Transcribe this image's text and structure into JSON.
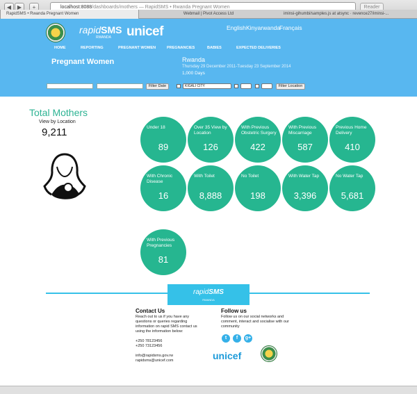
{
  "browser": {
    "url_host": "localhost:8088",
    "url_path": "/dashboards/mothers",
    "url_suffix": " — RapidSMS • Rwanda Pregnant Women",
    "reader_label": "Reader",
    "tabs": [
      "RapidSMS • Rwanda Pregnant Women",
      "Webmail | Pivot Access Ltd",
      "iminsi-gihumbi/samples.js at atsync · revence27/iminsi-..."
    ]
  },
  "header": {
    "logo_rapid": "rapid",
    "logo_sms": "SMS",
    "logo_rwanda": "RWANDA",
    "logo_unicef": "unicef",
    "languages": [
      "English",
      "Kinyarwanda",
      "Français"
    ],
    "menu": [
      "HOME",
      "REPORTING",
      "PREGNANT WOMEN",
      "PREGNANCIES",
      "BABIES",
      "EXPECTED DELIVERIES"
    ],
    "page_title": "Pregnant Women",
    "location": "Rwanda",
    "date_range": "Thursday 29 December 2011-Tuesday 23 September 2014",
    "days": "1,000 Days"
  },
  "filters": {
    "filter_date_label": "Filter Date",
    "province_value": "KIGALI CITY",
    "filter_location_label": "Filter Location"
  },
  "summary": {
    "title": "Total Mothers",
    "subtitle": "View by Location",
    "total": "9,211"
  },
  "stats": [
    {
      "label": "Under 18",
      "value": "89"
    },
    {
      "label": "Over 35 View by Location",
      "value": "126"
    },
    {
      "label": "With Previous Obstetric Surgery",
      "value": "422"
    },
    {
      "label": "With Previous Miscarriage",
      "value": "587"
    },
    {
      "label": "Previous Home Delivery",
      "value": "410"
    },
    {
      "label": "With Chronic Disease",
      "value": "16"
    },
    {
      "label": "With Toilet",
      "value": "8,888"
    },
    {
      "label": "No Toilet",
      "value": "198"
    },
    {
      "label": "With Water Tap",
      "value": "3,396"
    },
    {
      "label": "No Water Tap",
      "value": "5,681"
    },
    {
      "label": "With Previous Pregnancies",
      "value": "81"
    }
  ],
  "footer": {
    "logo_rapid": "rapid",
    "logo_sms": "SMS",
    "logo_rwanda": "RWANDA",
    "contact_title": "Contact Us",
    "contact_text": "Reach out to us if you have any questions or queries regarding information on rapid SMS contact us using the information below:",
    "phone1": "+250 78123456",
    "phone2": "+250 73123456",
    "email1": "info@rapidsms.gov.rw",
    "email2": "rapidsms@unicef.com",
    "follow_title": "Follow us",
    "follow_text": "Follow us on our social networks and comment, interact and socialise with our community",
    "unicef": "unicef"
  },
  "colors": {
    "header": "#58b7f0",
    "bubble": "#26b690",
    "accent": "#35c1e8",
    "title": "#2db393"
  },
  "icons": [
    "back-icon",
    "forward-icon",
    "twitter-icon",
    "facebook-icon",
    "google-plus-icon",
    "mother-child-icon",
    "national-crest-icon"
  ]
}
